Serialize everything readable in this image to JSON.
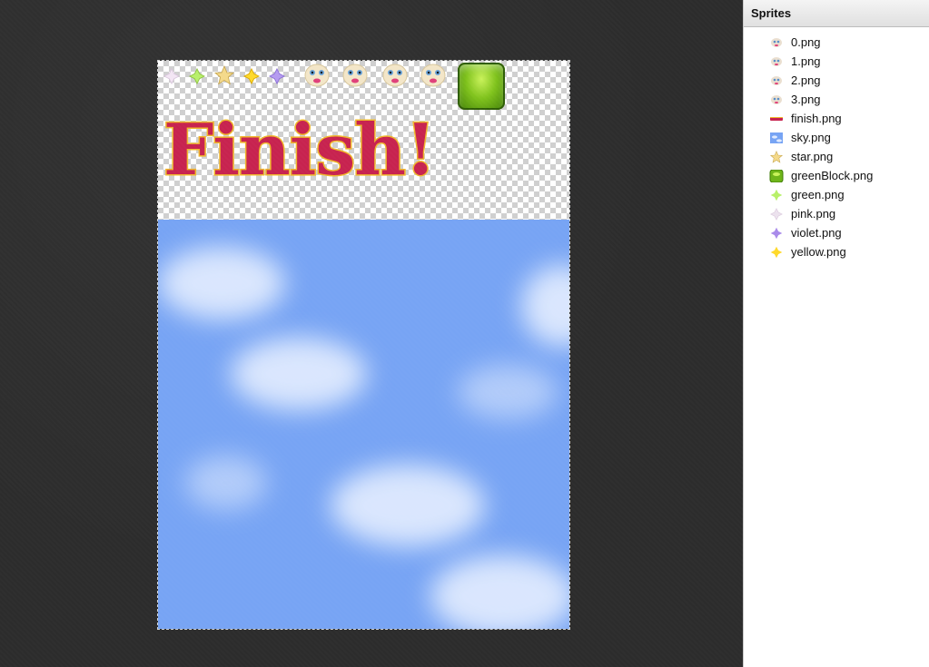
{
  "panel": {
    "title": "Sprites",
    "files": [
      {
        "name": "0.png",
        "icon": "face-icon"
      },
      {
        "name": "1.png",
        "icon": "face-icon"
      },
      {
        "name": "2.png",
        "icon": "face-icon"
      },
      {
        "name": "3.png",
        "icon": "face-icon"
      },
      {
        "name": "finish.png",
        "icon": "finish-text-icon"
      },
      {
        "name": "sky.png",
        "icon": "sky-icon"
      },
      {
        "name": "star.png",
        "icon": "star-icon"
      },
      {
        "name": "greenBlock.png",
        "icon": "green-block-icon"
      },
      {
        "name": "green.png",
        "icon": "green-gem-icon"
      },
      {
        "name": "pink.png",
        "icon": "pink-gem-icon"
      },
      {
        "name": "violet.png",
        "icon": "violet-gem-icon"
      },
      {
        "name": "yellow.png",
        "icon": "yellow-gem-icon"
      }
    ]
  },
  "canvas": {
    "finish_text": "Finish!",
    "background_color": "#2c2c2c",
    "sky_color": "#77a4f4",
    "finish_color": "#c7234f",
    "finish_outline": "#f0b72c"
  }
}
